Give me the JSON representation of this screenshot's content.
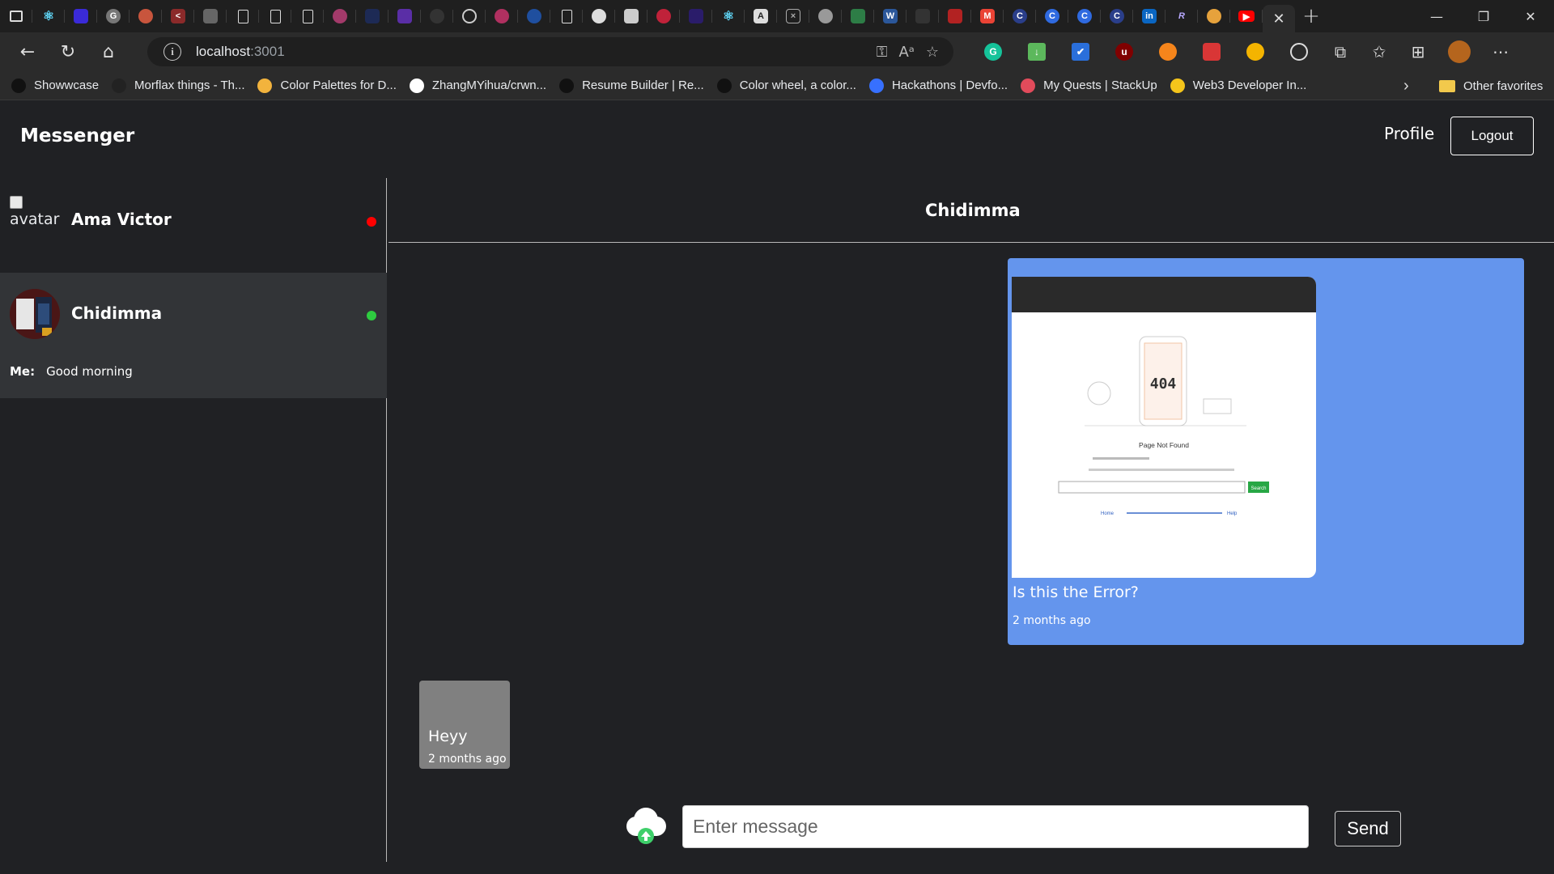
{
  "browser": {
    "url_host": "localhost",
    "url_port": ":3001",
    "bookmarks": [
      {
        "label": "Showwcase",
        "icon": "showwcase-icon",
        "color": "#111111"
      },
      {
        "label": "Morflax things - Th...",
        "icon": "morflax-icon",
        "color": "#222222"
      },
      {
        "label": "Color Palettes for D...",
        "icon": "palette-icon",
        "color": "#f2b33d"
      },
      {
        "label": "ZhangMYihua/crwn...",
        "icon": "github-icon",
        "color": "#ffffff"
      },
      {
        "label": "Resume Builder | Re...",
        "icon": "resume-icon",
        "color": "#111111"
      },
      {
        "label": "Color wheel, a color...",
        "icon": "color-wheel-icon",
        "color": "#111111"
      },
      {
        "label": "Hackathons | Devfo...",
        "icon": "devfolio-icon",
        "color": "#3770ff"
      },
      {
        "label": "My Quests | StackUp",
        "icon": "stackup-icon",
        "color": "#e24b5b"
      },
      {
        "label": "Web3 Developer In...",
        "icon": "web3-icon",
        "color": "#f5c51b"
      }
    ],
    "other_favorites": "Other favorites"
  },
  "app": {
    "brand": "Messenger",
    "nav": {
      "profile": "Profile",
      "logout": "Logout"
    },
    "conversations": [
      {
        "name": "Ama Victor",
        "avatar_alt": "avatar",
        "online": false,
        "status_color": "#ff0000"
      },
      {
        "name": "Chidimma",
        "online": true,
        "status_color": "#2ecc40",
        "last_sender": "Me:",
        "last_message": "Good morning",
        "selected": true
      }
    ],
    "chat": {
      "title": "Chidimma",
      "messages": [
        {
          "direction": "outgoing",
          "text": "Is this the Error?",
          "time": "2 months ago",
          "attachment": {
            "code": "404",
            "heading": "Page Not Found",
            "search_button": "Search",
            "links": [
              "Home",
              "Help"
            ]
          }
        },
        {
          "direction": "incoming",
          "text": "Heyy",
          "time": "2 months ago"
        }
      ],
      "composer": {
        "placeholder": "Enter message",
        "send": "Send"
      }
    }
  },
  "colors": {
    "outgoing_bubble": "#6495ed",
    "incoming_bubble": "#808080",
    "selected_conversation": "#323437"
  }
}
